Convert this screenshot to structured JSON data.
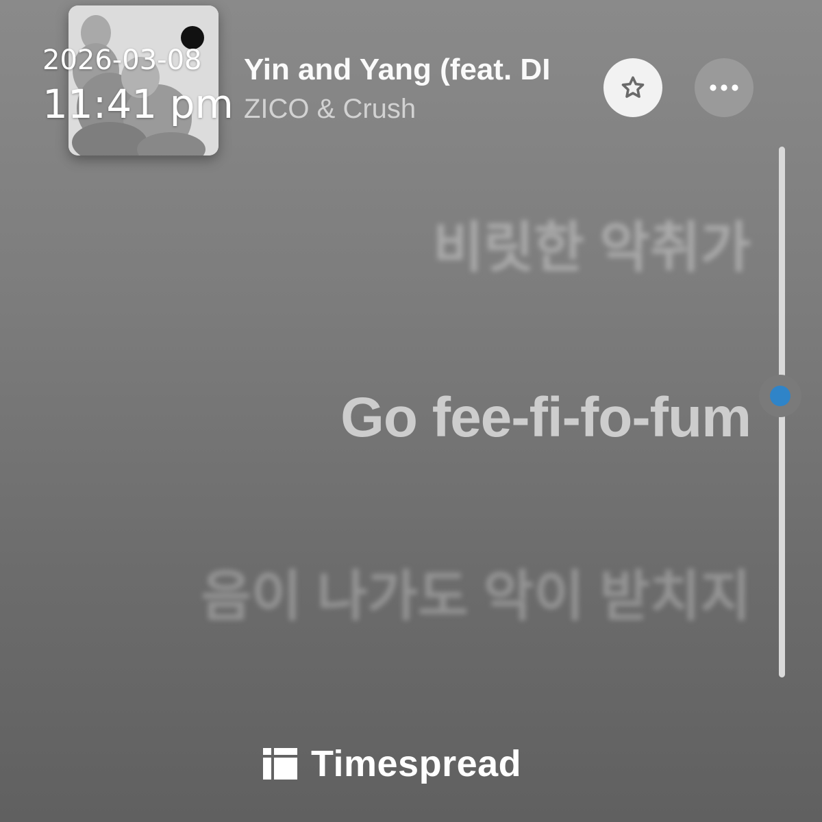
{
  "status": {
    "date": "2026-03-08",
    "time": "11:41 pm"
  },
  "track": {
    "title": "Yin and Yang (feat. DI",
    "artist": "ZICO & Crush",
    "album_art_icon": "album-cover-monkeys"
  },
  "controls": {
    "favorite_icon": "star-icon",
    "more_icon": "ellipsis-icon"
  },
  "lyrics": {
    "faint_line": "",
    "previous": "비릿한 악취가",
    "current": "Go fee-fi-fo-fum",
    "next": "음이 나가도 악이 받치지"
  },
  "scroll": {
    "position_fraction": 0.47,
    "accent_color": "#2f84c8"
  },
  "branding": {
    "name": "Timespread",
    "logo_icon": "timespread-logo-icon"
  }
}
